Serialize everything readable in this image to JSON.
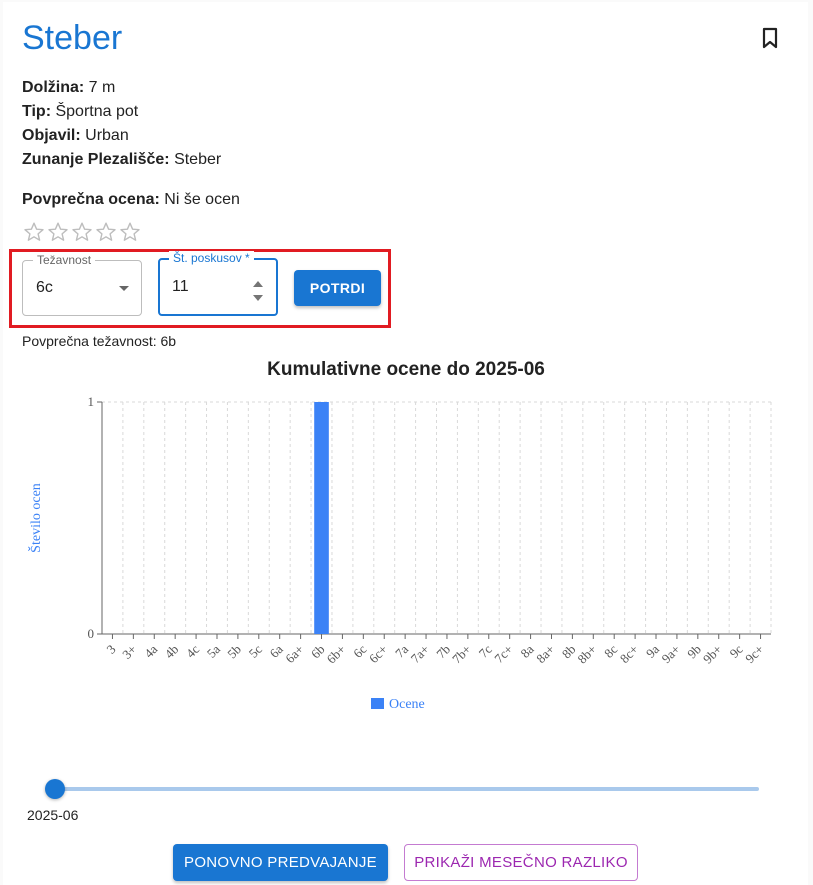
{
  "route": {
    "title": "Steber",
    "details": [
      {
        "label": "Dolžina:",
        "value": "7 m"
      },
      {
        "label": "Tip:",
        "value": "Športna pot"
      },
      {
        "label": "Objavil:",
        "value": "Urban"
      },
      {
        "label": "Zunanje Plezališče:",
        "value": "Steber"
      }
    ],
    "avg_rating": {
      "label": "Povprečna ocena:",
      "value": "Ni še ocen"
    },
    "stars_filled": 0,
    "stars_total": 5
  },
  "form": {
    "difficulty_legend": "Težavnost",
    "difficulty_value": "6c",
    "attempts_legend": "Št. poskusov *",
    "attempts_value": "11",
    "submit_label": "POTRDI"
  },
  "avg_difficulty": "Povprečna težavnost: 6b",
  "chart_data": {
    "type": "bar",
    "title": "Kumulativne ocene do 2025-06",
    "ylabel": "Število ocen",
    "xlabel": "",
    "ylim": [
      0,
      1
    ],
    "yticks": [
      "0",
      "1"
    ],
    "categories": [
      "3",
      "3+",
      "4a",
      "4b",
      "4c",
      "5a",
      "5b",
      "5c",
      "6a",
      "6a+",
      "6b",
      "6b+",
      "6c",
      "6c+",
      "7a",
      "7a+",
      "7b",
      "7b+",
      "7c",
      "7c+",
      "8a",
      "8a+",
      "8b",
      "8b+",
      "8c",
      "8c+",
      "9a",
      "9a+",
      "9b",
      "9b+",
      "9c",
      "9c+"
    ],
    "series": [
      {
        "name": "Ocene",
        "values": [
          0,
          0,
          0,
          0,
          0,
          0,
          0,
          0,
          0,
          0,
          1,
          0,
          0,
          0,
          0,
          0,
          0,
          0,
          0,
          0,
          0,
          0,
          0,
          0,
          0,
          0,
          0,
          0,
          0,
          0,
          0,
          0
        ],
        "color": "#3b82f6"
      }
    ],
    "grid": true,
    "legend": "bottom"
  },
  "slider": {
    "value_label": "2025-06",
    "position": 0
  },
  "buttons": {
    "repredict": "PONOVNO PREDVAJANJE",
    "monthly_diff": "PRIKAŽI MESEČNO RAZLIKO"
  },
  "colors": {
    "accent": "#1976d2",
    "bar": "#3b82f6",
    "highlight": "#e11b22",
    "secondary": "#9c27b0"
  }
}
